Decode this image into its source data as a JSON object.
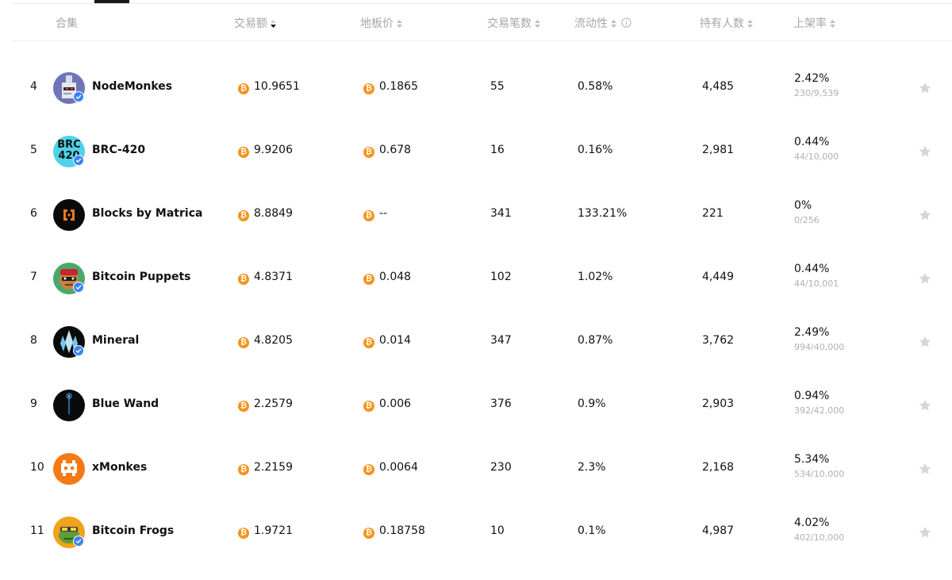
{
  "header": {
    "collection": "合集",
    "volume": "交易额",
    "floor_price": "地板价",
    "sales": "交易笔数",
    "liquidity": "流动性",
    "owners": "持有人数",
    "listed_rate": "上架率"
  },
  "colors": {
    "btc": "#f7931a",
    "verified": "#3b82f6",
    "star": "#d6d6d6"
  },
  "rows": [
    {
      "rank": "4",
      "name": "NodeMonkes",
      "volume": "10.9651",
      "floor": "0.1865",
      "sales": "55",
      "liquidity": "0.58%",
      "owners": "4,485",
      "listed_pct": "2.42%",
      "listed_sub": "230/9,539",
      "verified": true,
      "avatar": "nodemonkes"
    },
    {
      "rank": "5",
      "name": "BRC-420",
      "volume": "9.9206",
      "floor": "0.678",
      "sales": "16",
      "liquidity": "0.16%",
      "owners": "2,981",
      "listed_pct": "0.44%",
      "listed_sub": "44/10,000",
      "verified": true,
      "avatar": "brc420",
      "avatar_text": "BRC 420"
    },
    {
      "rank": "6",
      "name": "Blocks by Matrica",
      "volume": "8.8849",
      "floor": "--",
      "sales": "341",
      "liquidity": "133.21%",
      "owners": "221",
      "listed_pct": "0%",
      "listed_sub": "0/256",
      "verified": false,
      "avatar": "blocks"
    },
    {
      "rank": "7",
      "name": "Bitcoin Puppets",
      "volume": "4.8371",
      "floor": "0.048",
      "sales": "102",
      "liquidity": "1.02%",
      "owners": "4,449",
      "listed_pct": "0.44%",
      "listed_sub": "44/10,001",
      "verified": true,
      "avatar": "puppets"
    },
    {
      "rank": "8",
      "name": "Mineral",
      "volume": "4.8205",
      "floor": "0.014",
      "sales": "347",
      "liquidity": "0.87%",
      "owners": "3,762",
      "listed_pct": "2.49%",
      "listed_sub": "994/40,000",
      "verified": true,
      "avatar": "mineral"
    },
    {
      "rank": "9",
      "name": "Blue Wand",
      "volume": "2.2579",
      "floor": "0.006",
      "sales": "376",
      "liquidity": "0.9%",
      "owners": "2,903",
      "listed_pct": "0.94%",
      "listed_sub": "392/42,000",
      "verified": false,
      "avatar": "bluewand"
    },
    {
      "rank": "10",
      "name": "xMonkes",
      "volume": "2.2159",
      "floor": "0.0064",
      "sales": "230",
      "liquidity": "2.3%",
      "owners": "2,168",
      "listed_pct": "5.34%",
      "listed_sub": "534/10,000",
      "verified": false,
      "avatar": "xmonkes"
    },
    {
      "rank": "11",
      "name": "Bitcoin Frogs",
      "volume": "1.9721",
      "floor": "0.18758",
      "sales": "10",
      "liquidity": "0.1%",
      "owners": "4,987",
      "listed_pct": "4.02%",
      "listed_sub": "402/10,000",
      "verified": true,
      "avatar": "frogs"
    }
  ]
}
